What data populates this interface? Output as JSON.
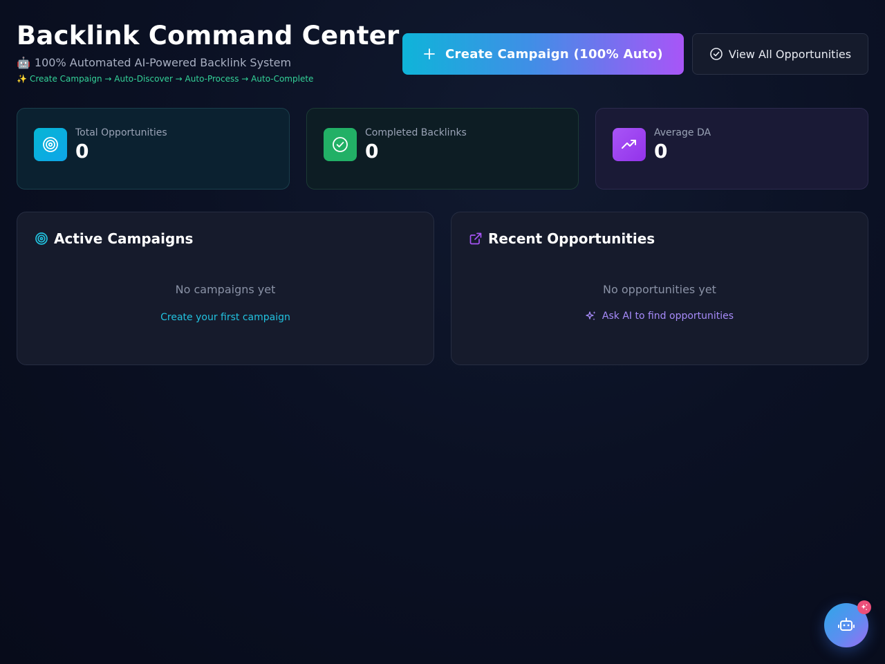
{
  "header": {
    "title": "Backlink Command Center",
    "subtitle_emoji": "🤖",
    "subtitle": "100% Automated AI-Powered Backlink System",
    "flow_emoji": "✨",
    "flow": "Create Campaign → Auto-Discover → Auto-Process → Auto-Complete"
  },
  "actions": {
    "create_campaign": "Create Campaign (100% Auto)",
    "view_all": "View All Opportunities"
  },
  "stats": [
    {
      "label": "Total Opportunities",
      "value": "0",
      "icon": "target-icon"
    },
    {
      "label": "Completed Backlinks",
      "value": "0",
      "icon": "check-circle-icon"
    },
    {
      "label": "Average DA",
      "value": "0",
      "icon": "trending-up-icon"
    }
  ],
  "campaigns": {
    "title": "Active Campaigns",
    "empty": "No campaigns yet",
    "link": "Create your first campaign"
  },
  "opportunities": {
    "title": "Recent Opportunities",
    "empty": "No opportunities yet",
    "link": "Ask AI to find opportunities"
  },
  "colors": {
    "accent_cyan": "#0fb4d9",
    "accent_purple": "#a855f7",
    "success_green": "#22b066",
    "badge_pink": "#ec4f7a"
  }
}
